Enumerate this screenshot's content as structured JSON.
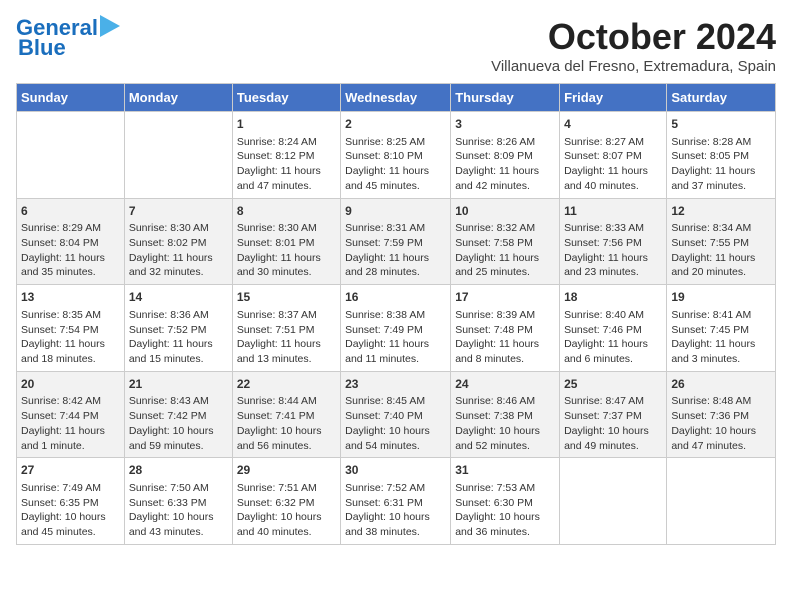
{
  "logo": {
    "line1": "General",
    "line2": "Blue"
  },
  "title": "October 2024",
  "subtitle": "Villanueva del Fresno, Extremadura, Spain",
  "days_of_week": [
    "Sunday",
    "Monday",
    "Tuesday",
    "Wednesday",
    "Thursday",
    "Friday",
    "Saturday"
  ],
  "weeks": [
    [
      {
        "day": "",
        "info": ""
      },
      {
        "day": "",
        "info": ""
      },
      {
        "day": "1",
        "info": "Sunrise: 8:24 AM\nSunset: 8:12 PM\nDaylight: 11 hours and 47 minutes."
      },
      {
        "day": "2",
        "info": "Sunrise: 8:25 AM\nSunset: 8:10 PM\nDaylight: 11 hours and 45 minutes."
      },
      {
        "day": "3",
        "info": "Sunrise: 8:26 AM\nSunset: 8:09 PM\nDaylight: 11 hours and 42 minutes."
      },
      {
        "day": "4",
        "info": "Sunrise: 8:27 AM\nSunset: 8:07 PM\nDaylight: 11 hours and 40 minutes."
      },
      {
        "day": "5",
        "info": "Sunrise: 8:28 AM\nSunset: 8:05 PM\nDaylight: 11 hours and 37 minutes."
      }
    ],
    [
      {
        "day": "6",
        "info": "Sunrise: 8:29 AM\nSunset: 8:04 PM\nDaylight: 11 hours and 35 minutes."
      },
      {
        "day": "7",
        "info": "Sunrise: 8:30 AM\nSunset: 8:02 PM\nDaylight: 11 hours and 32 minutes."
      },
      {
        "day": "8",
        "info": "Sunrise: 8:30 AM\nSunset: 8:01 PM\nDaylight: 11 hours and 30 minutes."
      },
      {
        "day": "9",
        "info": "Sunrise: 8:31 AM\nSunset: 7:59 PM\nDaylight: 11 hours and 28 minutes."
      },
      {
        "day": "10",
        "info": "Sunrise: 8:32 AM\nSunset: 7:58 PM\nDaylight: 11 hours and 25 minutes."
      },
      {
        "day": "11",
        "info": "Sunrise: 8:33 AM\nSunset: 7:56 PM\nDaylight: 11 hours and 23 minutes."
      },
      {
        "day": "12",
        "info": "Sunrise: 8:34 AM\nSunset: 7:55 PM\nDaylight: 11 hours and 20 minutes."
      }
    ],
    [
      {
        "day": "13",
        "info": "Sunrise: 8:35 AM\nSunset: 7:54 PM\nDaylight: 11 hours and 18 minutes."
      },
      {
        "day": "14",
        "info": "Sunrise: 8:36 AM\nSunset: 7:52 PM\nDaylight: 11 hours and 15 minutes."
      },
      {
        "day": "15",
        "info": "Sunrise: 8:37 AM\nSunset: 7:51 PM\nDaylight: 11 hours and 13 minutes."
      },
      {
        "day": "16",
        "info": "Sunrise: 8:38 AM\nSunset: 7:49 PM\nDaylight: 11 hours and 11 minutes."
      },
      {
        "day": "17",
        "info": "Sunrise: 8:39 AM\nSunset: 7:48 PM\nDaylight: 11 hours and 8 minutes."
      },
      {
        "day": "18",
        "info": "Sunrise: 8:40 AM\nSunset: 7:46 PM\nDaylight: 11 hours and 6 minutes."
      },
      {
        "day": "19",
        "info": "Sunrise: 8:41 AM\nSunset: 7:45 PM\nDaylight: 11 hours and 3 minutes."
      }
    ],
    [
      {
        "day": "20",
        "info": "Sunrise: 8:42 AM\nSunset: 7:44 PM\nDaylight: 11 hours and 1 minute."
      },
      {
        "day": "21",
        "info": "Sunrise: 8:43 AM\nSunset: 7:42 PM\nDaylight: 10 hours and 59 minutes."
      },
      {
        "day": "22",
        "info": "Sunrise: 8:44 AM\nSunset: 7:41 PM\nDaylight: 10 hours and 56 minutes."
      },
      {
        "day": "23",
        "info": "Sunrise: 8:45 AM\nSunset: 7:40 PM\nDaylight: 10 hours and 54 minutes."
      },
      {
        "day": "24",
        "info": "Sunrise: 8:46 AM\nSunset: 7:38 PM\nDaylight: 10 hours and 52 minutes."
      },
      {
        "day": "25",
        "info": "Sunrise: 8:47 AM\nSunset: 7:37 PM\nDaylight: 10 hours and 49 minutes."
      },
      {
        "day": "26",
        "info": "Sunrise: 8:48 AM\nSunset: 7:36 PM\nDaylight: 10 hours and 47 minutes."
      }
    ],
    [
      {
        "day": "27",
        "info": "Sunrise: 7:49 AM\nSunset: 6:35 PM\nDaylight: 10 hours and 45 minutes."
      },
      {
        "day": "28",
        "info": "Sunrise: 7:50 AM\nSunset: 6:33 PM\nDaylight: 10 hours and 43 minutes."
      },
      {
        "day": "29",
        "info": "Sunrise: 7:51 AM\nSunset: 6:32 PM\nDaylight: 10 hours and 40 minutes."
      },
      {
        "day": "30",
        "info": "Sunrise: 7:52 AM\nSunset: 6:31 PM\nDaylight: 10 hours and 38 minutes."
      },
      {
        "day": "31",
        "info": "Sunrise: 7:53 AM\nSunset: 6:30 PM\nDaylight: 10 hours and 36 minutes."
      },
      {
        "day": "",
        "info": ""
      },
      {
        "day": "",
        "info": ""
      }
    ]
  ]
}
